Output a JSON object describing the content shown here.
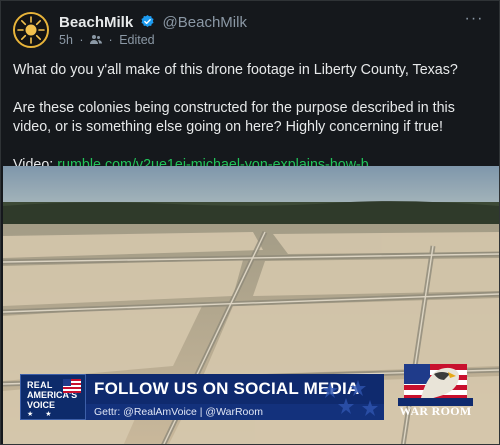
{
  "post": {
    "display_name": "BeachMilk",
    "handle": "@BeachMilk",
    "time": "5h",
    "separator1": "·",
    "separator2": "·",
    "edited_label": "Edited",
    "more_glyph": "···",
    "paragraph1": "What do you y'all make of this drone footage in Liberty County, Texas?",
    "paragraph2": "Are these colonies being constructed for the purpose described in this video, or is something else going on here? Highly concerning if true!",
    "video_prefix": "Video:",
    "video_link": "rumble.com/v2ue1ei-michael-yon-explains-how-b..."
  },
  "media": {
    "rav_logo": {
      "line1": "REAL",
      "line2": "AMERICA'S",
      "line3": "VOICE"
    },
    "banner_title": "FOLLOW US ON SOCIAL MEDIA",
    "banner_sub": "Gettr: @RealAmVoice | @WarRoom",
    "warroom_logo": "WAR ROOM"
  },
  "colors": {
    "link": "#21c45a",
    "verified": "#1d9bf0",
    "banner_blue": "#0f2a6e",
    "avatar_ring": "#e8b43a"
  },
  "icons": {
    "verified": "verified-badge-icon",
    "audience": "audience-icon",
    "more": "more-options-icon"
  }
}
